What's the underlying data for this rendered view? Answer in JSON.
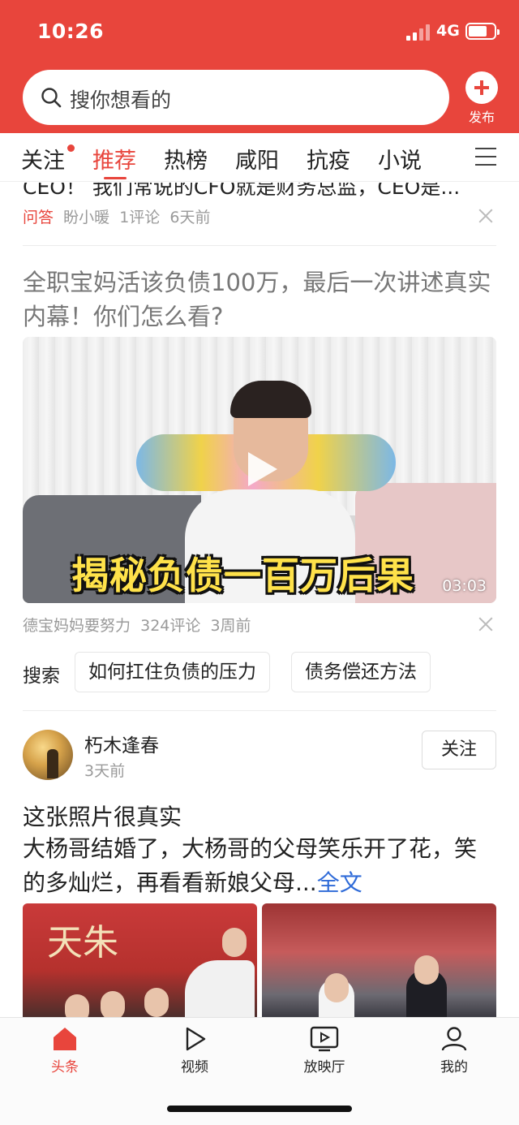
{
  "status_bar": {
    "time": "10:26",
    "network": "4G"
  },
  "search": {
    "placeholder": "搜你想看的"
  },
  "publish": {
    "label": "发布"
  },
  "tabs": [
    {
      "label": "关注",
      "has_dot": true
    },
    {
      "label": "推荐",
      "active": true
    },
    {
      "label": "热榜"
    },
    {
      "label": "咸阳"
    },
    {
      "label": "抗疫"
    },
    {
      "label": "小说"
    }
  ],
  "feed": {
    "item1": {
      "title_partial": "CEO！  我们常说的CFO就是财务总监，CEO是...",
      "tag": "问答",
      "author": "盼小暖",
      "comments": "1评论",
      "time": "6天前"
    },
    "item2": {
      "title": "全职宝妈活该负债100万，最后一次讲述真实内幕！你们怎么看?",
      "video_caption": "揭秘负债一百万后果",
      "duration": "03:03",
      "author": "德宝妈妈要努力",
      "comments": "324评论",
      "time": "3周前"
    },
    "related_search": {
      "label": "搜索",
      "chips": [
        "如何扛住负债的压力",
        "债务偿还方法"
      ]
    },
    "item3": {
      "author": "朽木逢春",
      "time": "3天前",
      "follow_label": "关注",
      "title": "这张照片很真实",
      "body": "大杨哥结婚了，大杨哥的父母笑乐开了花，笑的多灿烂，再看看新娘父母...",
      "more_label": "全文",
      "photo_text": "天朱"
    }
  },
  "bottom_nav": [
    {
      "label": "头条",
      "icon": "home-icon",
      "active": true
    },
    {
      "label": "视频",
      "icon": "play-icon"
    },
    {
      "label": "放映厅",
      "icon": "tv-icon"
    },
    {
      "label": "我的",
      "icon": "user-icon"
    }
  ],
  "colors": {
    "brand_red": "#e8453c",
    "link_blue": "#2f6bd8",
    "meta_gray": "#9a9a9a"
  }
}
